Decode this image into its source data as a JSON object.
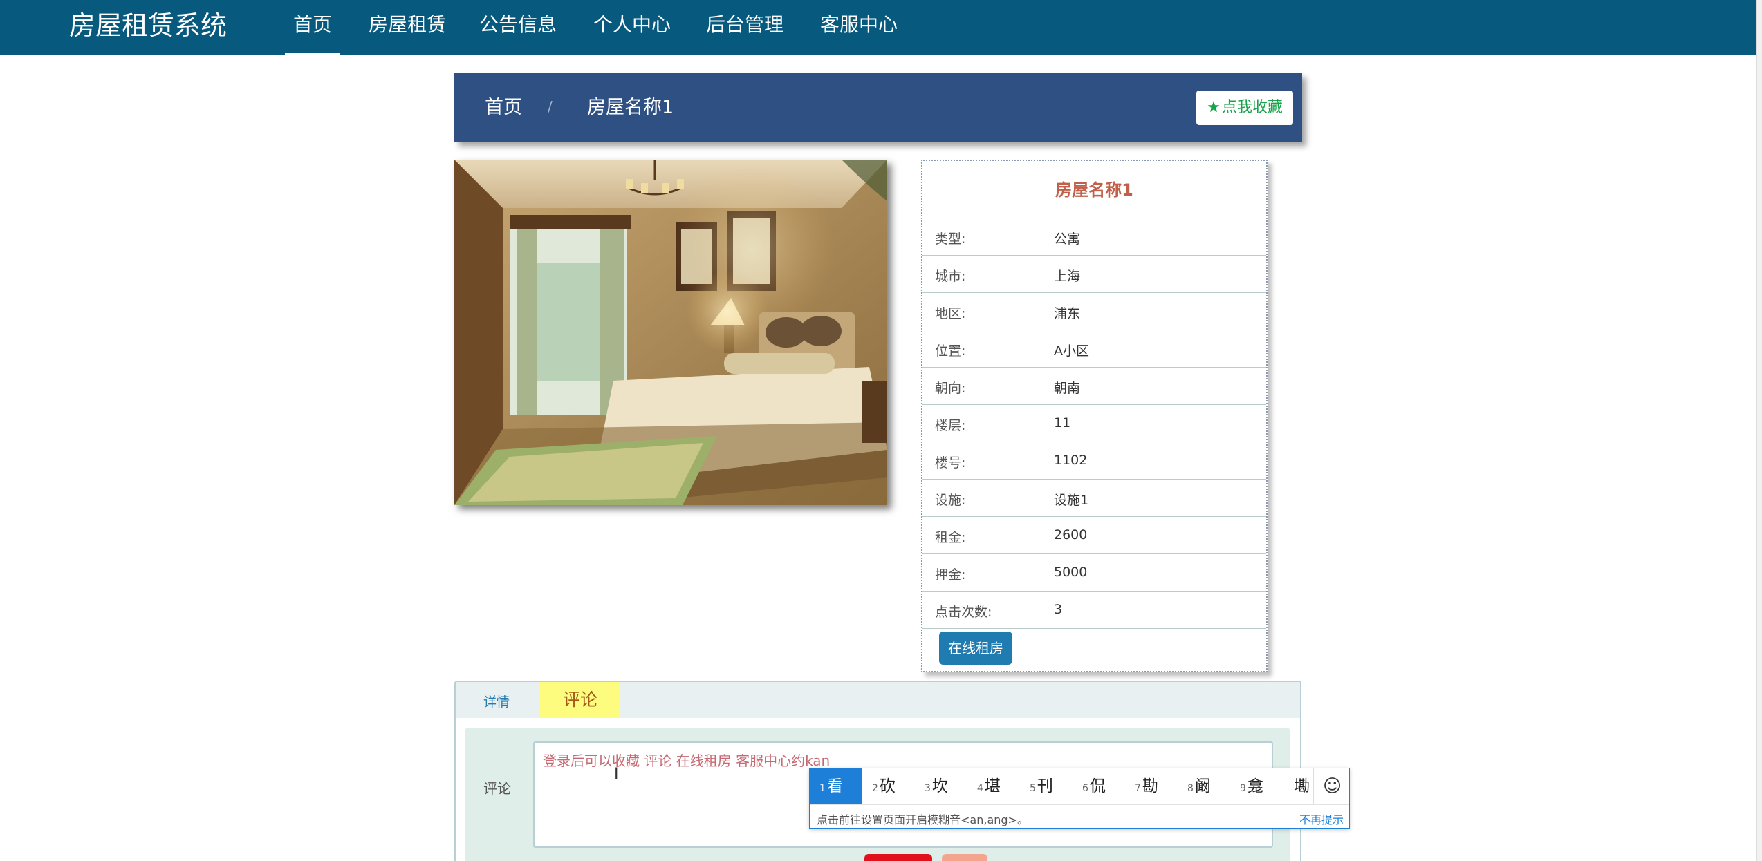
{
  "nav": {
    "brand": "房屋租赁系统",
    "items": [
      {
        "label": "首页",
        "active": true
      },
      {
        "label": "房屋租赁"
      },
      {
        "label": "公告信息"
      },
      {
        "label": "个人中心"
      },
      {
        "label": "后台管理"
      },
      {
        "label": "客服中心"
      }
    ]
  },
  "breadcrumb": {
    "home": "首页",
    "separator": "/",
    "current": "房屋名称1"
  },
  "favorite_button": {
    "icon": "star-icon",
    "label": "点我收藏",
    "color": "#17a34a"
  },
  "house": {
    "title": "房屋名称1",
    "image_alt": "bedroom-photo",
    "fields": [
      {
        "key": "类型:",
        "value": "公寓"
      },
      {
        "key": "城市:",
        "value": "上海"
      },
      {
        "key": "地区:",
        "value": "浦东"
      },
      {
        "key": "位置:",
        "value": "A小区"
      },
      {
        "key": "朝向:",
        "value": "朝南"
      },
      {
        "key": "楼层:",
        "value": "11"
      },
      {
        "key": "楼号:",
        "value": "1102"
      },
      {
        "key": "设施:",
        "value": "设施1"
      },
      {
        "key": "租金:",
        "value": "2600"
      },
      {
        "key": "押金:",
        "value": "5000"
      },
      {
        "key": "点击次数:",
        "value": "3"
      }
    ],
    "rent_button": "在线租房"
  },
  "tabs": {
    "detail": "详情",
    "comment": "评论"
  },
  "comment": {
    "label": "评论",
    "value": "登录后可以收藏  评论  在线租房  客服中心约kan"
  },
  "ime": {
    "candidates": [
      {
        "n": "1",
        "c": "看"
      },
      {
        "n": "2",
        "c": "砍"
      },
      {
        "n": "3",
        "c": "坎"
      },
      {
        "n": "4",
        "c": "堪"
      },
      {
        "n": "5",
        "c": "刊"
      },
      {
        "n": "6",
        "c": "侃"
      },
      {
        "n": "7",
        "c": "勘"
      },
      {
        "n": "8",
        "c": "阚"
      },
      {
        "n": "9",
        "c": "龛"
      },
      {
        "n": "",
        "c": "墈"
      }
    ],
    "hint": "点击前往设置页面开启模糊音<an,ang>。",
    "dismiss": "不再提示",
    "emoji_icon": "smiley-icon"
  },
  "colors": {
    "nav_bg": "#075a7e",
    "breadcrumb_bg": "#2f5083",
    "title_color": "#c0604a",
    "active_tab_bg": "#fdfc7e",
    "ime_accent": "#1e7fd8"
  }
}
